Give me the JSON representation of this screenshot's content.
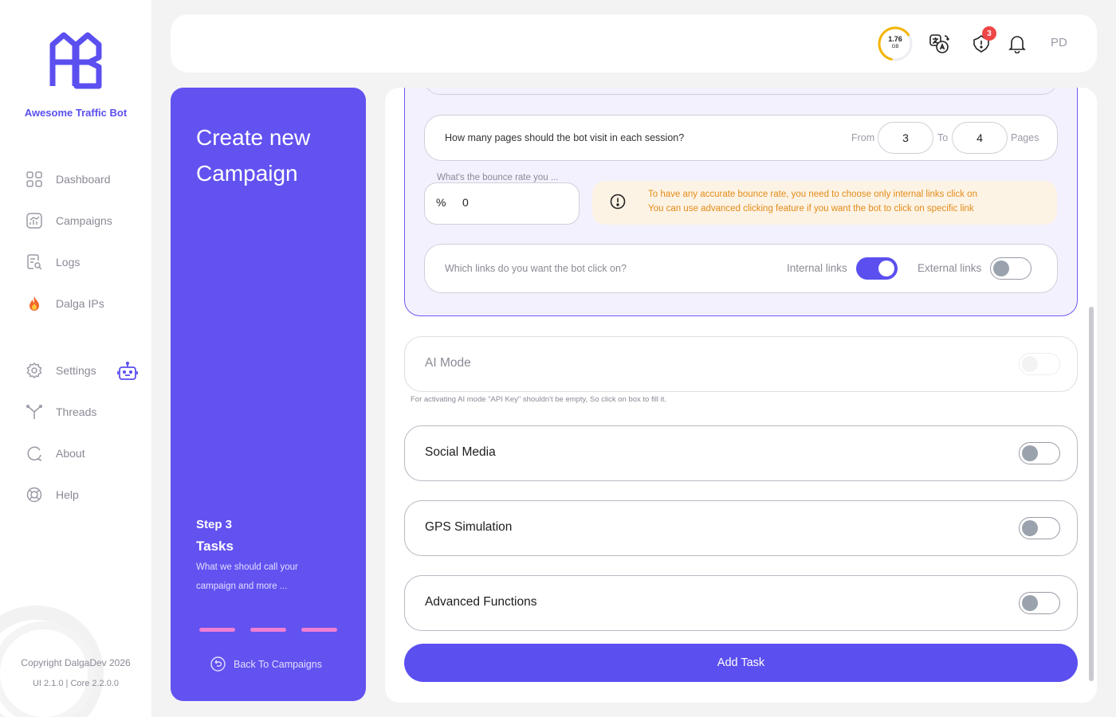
{
  "sidebar": {
    "brand": "Awesome Traffic Bot",
    "items": [
      {
        "label": "Dashboard",
        "icon": "dashboard-icon"
      },
      {
        "label": "Campaigns",
        "icon": "campaigns-icon"
      },
      {
        "label": "Logs",
        "icon": "logs-icon"
      },
      {
        "label": "Dalga IPs",
        "icon": "fire-icon"
      },
      {
        "label": "Settings",
        "icon": "gear-icon"
      },
      {
        "label": "Threads",
        "icon": "threads-icon"
      },
      {
        "label": "About",
        "icon": "about-icon"
      },
      {
        "label": "Help",
        "icon": "lifebuoy-icon"
      }
    ],
    "copyright": "Copyright DalgaDev 2026",
    "version": "UI 2.1.0 | Core 2.2.0.0"
  },
  "topbar": {
    "storage_value": "1.76",
    "storage_unit": "GB",
    "notification_badge": "3",
    "avatar_initials": "PD",
    "colors": {
      "storage_ring": "#f4b400",
      "badge": "#ee4646"
    }
  },
  "step_panel": {
    "title": "Create new Campaign",
    "step_number": "Step 3",
    "step_name": "Tasks",
    "step_description": "What we should call your campaign and more ...",
    "back_label": "Back To Campaigns"
  },
  "form": {
    "pages_question": "How many pages should the bot visit in each session?",
    "from_label": "From",
    "from_value": "3",
    "to_label": "To",
    "to_value": "4",
    "pages_label": "Pages",
    "bounce_label": "What's the bounce rate you ...",
    "bounce_symbol": "%",
    "bounce_value": "0",
    "warning_line1": "To have any accurate bounce rate, you need to choose only internal links click on",
    "warning_line2": "You can use advanced clicking feature if you want the bot to click on specific link",
    "links_question": "Which links do you want the bot click on?",
    "internal_links_label": "Internal links",
    "internal_links_on": true,
    "external_links_label": "External links",
    "external_links_on": false
  },
  "features": {
    "ai_mode_label": "AI Mode",
    "ai_hint": "For activating AI mode \"API Key\" shouldn't be empty, So click on box to fill it.",
    "social_media_label": "Social Media",
    "gps_label": "GPS Simulation",
    "advanced_label": "Advanced Functions"
  },
  "add_task_label": "Add Task",
  "accent_color": "#5b4ff0"
}
